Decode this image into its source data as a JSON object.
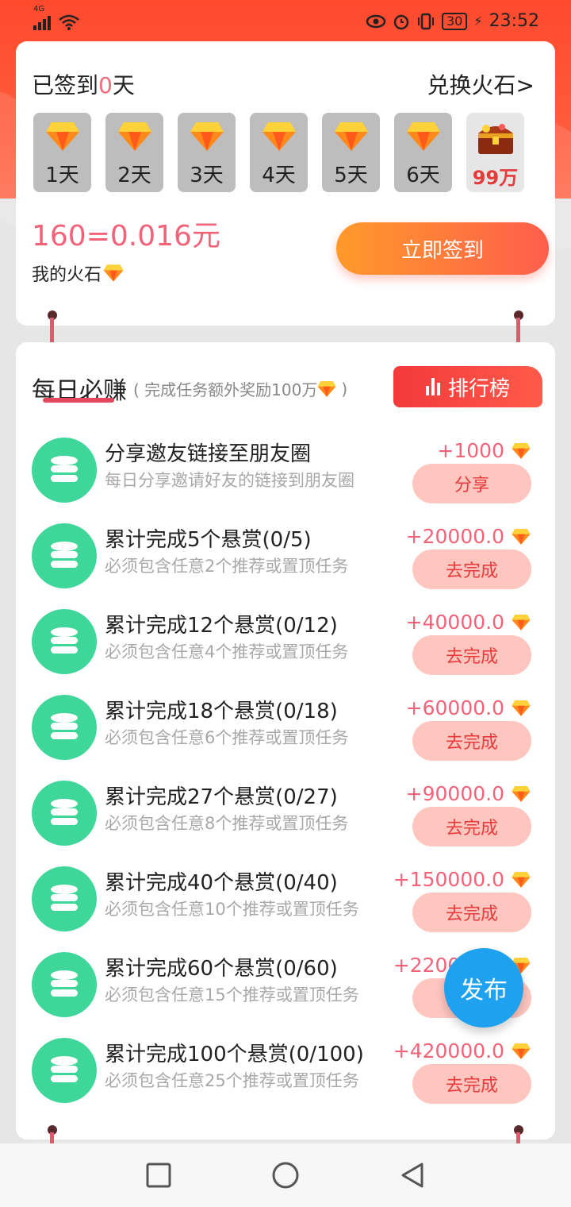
{
  "status_bar": {
    "network": "4G",
    "battery": "30",
    "time": "23:52"
  },
  "signin": {
    "title_prefix": "已签到",
    "days_signed": "0",
    "title_suffix": "天",
    "exchange_link": "兑换火石>",
    "days": [
      {
        "label": "1天"
      },
      {
        "label": "2天"
      },
      {
        "label": "3天"
      },
      {
        "label": "4天"
      },
      {
        "label": "5天"
      },
      {
        "label": "6天"
      },
      {
        "label": "99万"
      }
    ],
    "balance": "160=0.016元",
    "my_stone_label": "我的火石",
    "sign_button": "立即签到"
  },
  "daily": {
    "title": "每日必赚",
    "subtitle": "( 完成任务额外奖励100万",
    "subtitle_end": ")",
    "rank_button": "排行榜",
    "tasks": [
      {
        "title": "分享邀友链接至朋友圈",
        "desc": "每日分享邀请好友的链接到朋友圈",
        "reward": "+1000",
        "button": "分享"
      },
      {
        "title": "累计完成5个悬赏(0/5)",
        "desc": "必须包含任意2个推荐或置顶任务",
        "reward": "+20000.0",
        "button": "去完成"
      },
      {
        "title": "累计完成12个悬赏(0/12)",
        "desc": "必须包含任意4个推荐或置顶任务",
        "reward": "+40000.0",
        "button": "去完成"
      },
      {
        "title": "累计完成18个悬赏(0/18)",
        "desc": "必须包含任意6个推荐或置顶任务",
        "reward": "+60000.0",
        "button": "去完成"
      },
      {
        "title": "累计完成27个悬赏(0/27)",
        "desc": "必须包含任意8个推荐或置顶任务",
        "reward": "+90000.0",
        "button": "去完成"
      },
      {
        "title": "累计完成40个悬赏(0/40)",
        "desc": "必须包含任意10个推荐或置顶任务",
        "reward": "+150000.0",
        "button": "去完成"
      },
      {
        "title": "累计完成60个悬赏(0/60)",
        "desc": "必须包含任意15个推荐或置顶任务",
        "reward": "+220000.0",
        "button": "去完成"
      },
      {
        "title": "累计完成100个悬赏(0/100)",
        "desc": "必须包含任意25个推荐或置顶任务",
        "reward": "+420000.0",
        "button": "去完成"
      }
    ]
  },
  "fab": {
    "label": "发布"
  },
  "colors": {
    "accent_red": "#f2637a",
    "coin_green": "#3fd69a",
    "fab_blue": "#1ea2f0",
    "button_pink": "#ffc6c0"
  }
}
